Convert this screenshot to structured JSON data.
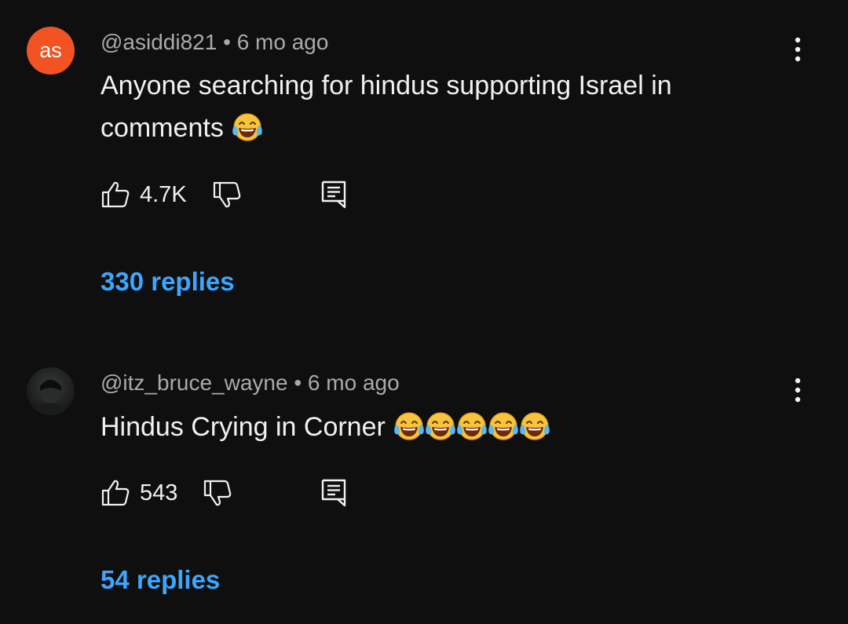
{
  "comments": [
    {
      "avatar_initials": "as",
      "avatar_color": "#f25322",
      "author": "@asiddi821",
      "separator": "•",
      "time": "6 mo ago",
      "text": "Anyone searching for hindus supporting Israel in comments",
      "emojis": [
        "face-with-tears-of-joy"
      ],
      "likes": "4.7K",
      "replies_label": "330 replies"
    },
    {
      "avatar_initials": "",
      "author": "@itz_bruce_wayne",
      "separator": "•",
      "time": "6 mo ago",
      "text": "Hindus Crying in Corner",
      "emojis": [
        "face-with-tears-of-joy",
        "face-with-tears-of-joy",
        "face-with-tears-of-joy",
        "face-with-tears-of-joy",
        "face-with-tears-of-joy"
      ],
      "likes": "543",
      "replies_label": "54 replies"
    }
  ],
  "colors": {
    "background": "#0f0f0f",
    "text_primary": "#f1f1f1",
    "text_secondary": "#aaaaaa",
    "link": "#3ea6ff"
  },
  "icons": {
    "like": "thumbs-up-icon",
    "dislike": "thumbs-down-icon",
    "reply": "reply-icon",
    "menu": "more-vertical-icon",
    "emoji": "face-with-tears-of-joy"
  }
}
